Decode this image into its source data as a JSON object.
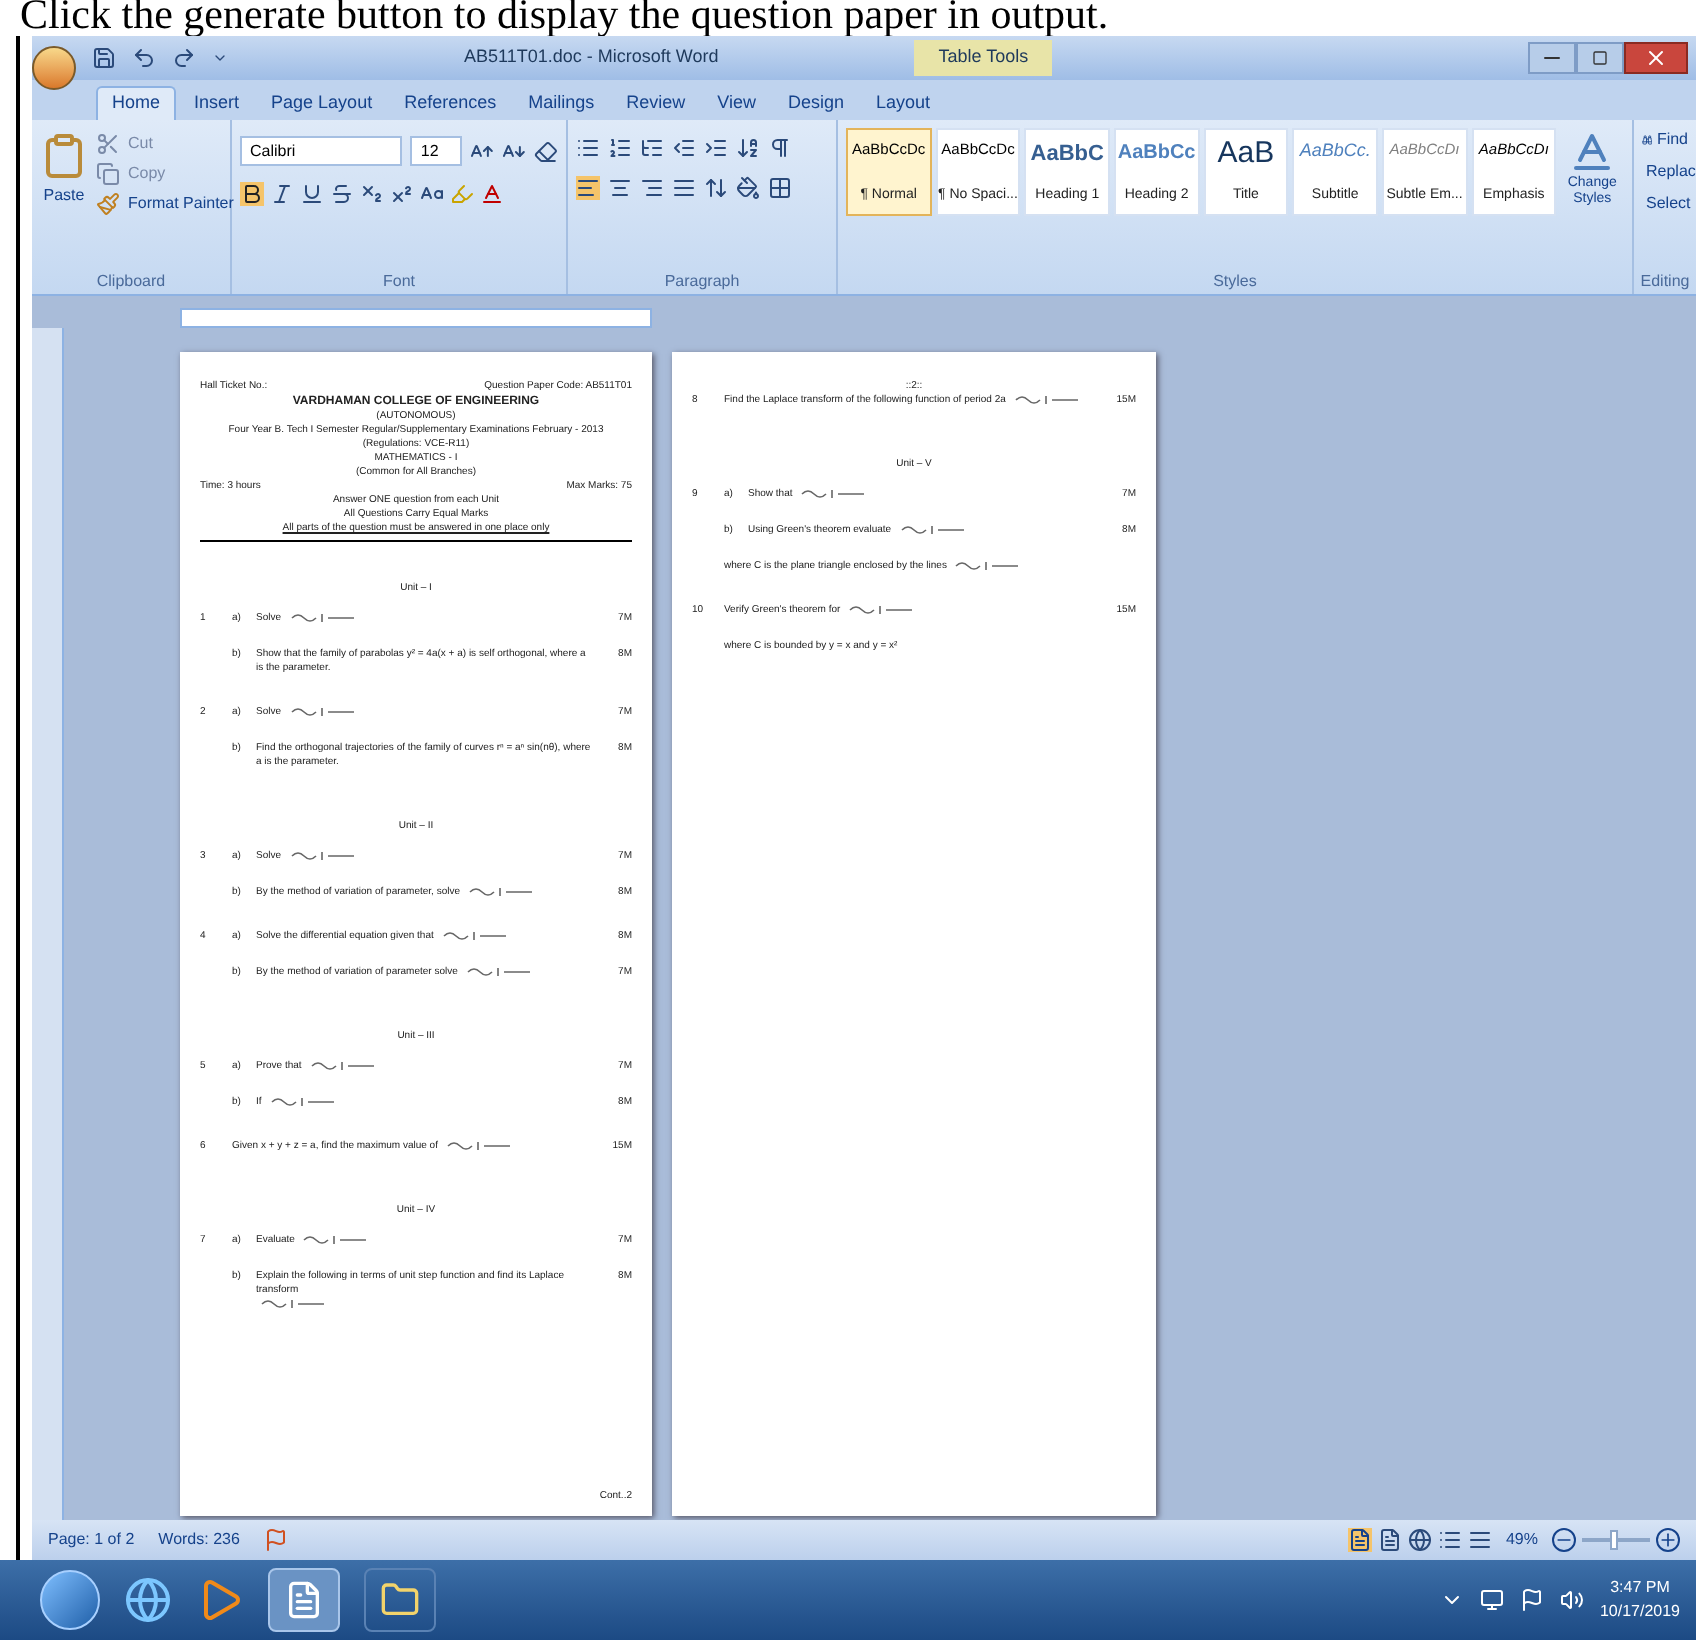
{
  "caption": "Click the generate button to display the question paper in output.",
  "window": {
    "title": "AB511T01.doc - Microsoft Word",
    "context_tab": "Table Tools"
  },
  "ribbon_tabs": [
    {
      "label": "Home",
      "selected": true
    },
    {
      "label": "Insert",
      "selected": false
    },
    {
      "label": "Page Layout",
      "selected": false
    },
    {
      "label": "References",
      "selected": false
    },
    {
      "label": "Mailings",
      "selected": false
    },
    {
      "label": "Review",
      "selected": false
    },
    {
      "label": "View",
      "selected": false
    },
    {
      "label": "Design",
      "selected": false
    },
    {
      "label": "Layout",
      "selected": false
    }
  ],
  "clipboard": {
    "paste": "Paste",
    "cut": "Cut",
    "copy": "Copy",
    "format_painter": "Format Painter",
    "label": "Clipboard"
  },
  "font": {
    "name": "Calibri",
    "size": "12",
    "label": "Font"
  },
  "paragraph": {
    "label": "Paragraph"
  },
  "styles": {
    "label": "Styles",
    "change": "Change Styles",
    "items": [
      {
        "preview": "AaBbCcDc",
        "label": "¶ Normal",
        "kind": "normal",
        "selected": true
      },
      {
        "preview": "AaBbCcDc",
        "label": "¶ No Spaci...",
        "kind": "normal",
        "selected": false
      },
      {
        "preview": "AaBbC",
        "label": "Heading 1",
        "kind": "heading1",
        "selected": false
      },
      {
        "preview": "AaBbCc",
        "label": "Heading 2",
        "kind": "heading2",
        "selected": false
      },
      {
        "preview": "AaB",
        "label": "Title",
        "kind": "title",
        "selected": false
      },
      {
        "preview": "AaBbCc.",
        "label": "Subtitle",
        "kind": "subtitle",
        "selected": false
      },
      {
        "preview": "AaBbCcDı",
        "label": "Subtle Em...",
        "kind": "subtle",
        "selected": false
      },
      {
        "preview": "AaBbCcDı",
        "label": "Emphasis",
        "kind": "emphasis",
        "selected": false
      }
    ]
  },
  "editing": {
    "label": "Editing",
    "find": "Find",
    "replace": "Replac",
    "select": "Select"
  },
  "pages": [
    {
      "blocks": [
        {
          "kind": "split",
          "left": "Hall Ticket No.:",
          "right": "Question Paper Code: AB511T01"
        },
        {
          "kind": "title",
          "text": "VARDHAMAN COLLEGE OF ENGINEERING"
        },
        {
          "kind": "center",
          "text": "(AUTONOMOUS)"
        },
        {
          "kind": "center",
          "text": "Four Year B. Tech I Semester Regular/Supplementary Examinations February - 2013"
        },
        {
          "kind": "center",
          "text": "(Regulations: VCE-R11)"
        },
        {
          "kind": "center",
          "text": "MATHEMATICS - I"
        },
        {
          "kind": "center",
          "text": "(Common for All Branches)"
        },
        {
          "kind": "split",
          "left": "Time: 3 hours",
          "right": "Max Marks: 75"
        },
        {
          "kind": "center",
          "text": "Answer ONE question from each Unit"
        },
        {
          "kind": "center",
          "text": "All Questions Carry Equal Marks"
        },
        {
          "kind": "rule",
          "text": "All parts of the question must be answered in one place only"
        },
        {
          "kind": "unit",
          "text": "Unit – I"
        },
        {
          "kind": "question",
          "number": "1",
          "parts": [
            {
              "label": "a)",
              "text": "Solve",
              "formula": true,
              "marks": "7M"
            },
            {
              "label": "b)",
              "text": "Show that the family of parabolas y² = 4a(x + a) is self orthogonal, where a is the parameter.",
              "formula": false,
              "marks": "8M"
            }
          ]
        },
        {
          "kind": "question",
          "number": "2",
          "parts": [
            {
              "label": "a)",
              "text": "Solve",
              "formula": true,
              "marks": "7M"
            },
            {
              "label": "b)",
              "text": "Find the orthogonal trajectories of the family of curves rⁿ = aⁿ sin(nθ), where a is the parameter.",
              "formula": false,
              "marks": "8M"
            }
          ]
        },
        {
          "kind": "unit",
          "text": "Unit – II"
        },
        {
          "kind": "question",
          "number": "3",
          "parts": [
            {
              "label": "a)",
              "text": "Solve",
              "formula": true,
              "marks": "7M"
            },
            {
              "label": "b)",
              "text": "By the method of variation of parameter, solve",
              "formula": true,
              "marks": "8M"
            }
          ]
        },
        {
          "kind": "question",
          "number": "4",
          "parts": [
            {
              "label": "a)",
              "text": "Solve the differential equation given that",
              "formula": true,
              "marks": "8M"
            },
            {
              "label": "b)",
              "text": "By the method of variation of parameter solve",
              "formula": true,
              "marks": "7M"
            }
          ]
        },
        {
          "kind": "unit",
          "text": "Unit – III"
        },
        {
          "kind": "question",
          "number": "5",
          "parts": [
            {
              "label": "a)",
              "text": "Prove that",
              "formula": true,
              "marks": "7M"
            },
            {
              "label": "b)",
              "text": "If",
              "formula": true,
              "marks": "8M"
            }
          ]
        },
        {
          "kind": "question",
          "number": "6",
          "parts": [
            {
              "text": "Given x + y + z = a, find the maximum value of",
              "formula": true,
              "marks": "15M"
            }
          ]
        },
        {
          "kind": "unit",
          "text": "Unit – IV"
        },
        {
          "kind": "question",
          "number": "7",
          "parts": [
            {
              "label": "a)",
              "text": "Evaluate",
              "formula": true,
              "marks": "7M"
            },
            {
              "label": "b)",
              "text": "Explain the following in terms of unit step function and find its Laplace transform",
              "formula": true,
              "marks": "8M"
            }
          ]
        },
        {
          "kind": "footer",
          "text": "Cont..2"
        }
      ]
    },
    {
      "blocks": [
        {
          "kind": "center",
          "text": "::2::"
        },
        {
          "kind": "question",
          "number": "8",
          "parts": [
            {
              "text": "Find the Laplace transform of the following function of period 2a",
              "formula": true,
              "marks": "15M"
            }
          ]
        },
        {
          "kind": "unit",
          "text": "Unit – V"
        },
        {
          "kind": "question",
          "number": "9",
          "parts": [
            {
              "label": "a)",
              "text": "Show that",
              "formula": true,
              "marks": "7M"
            },
            {
              "label": "b)",
              "text": "Using Green's theorem evaluate",
              "formula": true,
              "marks": "8M"
            },
            {
              "text": "where C is the plane triangle enclosed by the lines",
              "formula": true
            }
          ]
        },
        {
          "kind": "question",
          "number": "10",
          "parts": [
            {
              "text": "Verify Green's theorem for",
              "formula": true,
              "marks": "15M"
            },
            {
              "text": "where C is bounded by y = x and y = x²",
              "formula": false
            }
          ]
        }
      ]
    }
  ],
  "status": {
    "page": "Page: 1 of 2",
    "words": "Words: 236",
    "zoom": "49%",
    "zoom_slider": {
      "level": 0.45
    }
  },
  "taskbar": {
    "time": "3:47 PM",
    "date": "10/17/2019"
  }
}
